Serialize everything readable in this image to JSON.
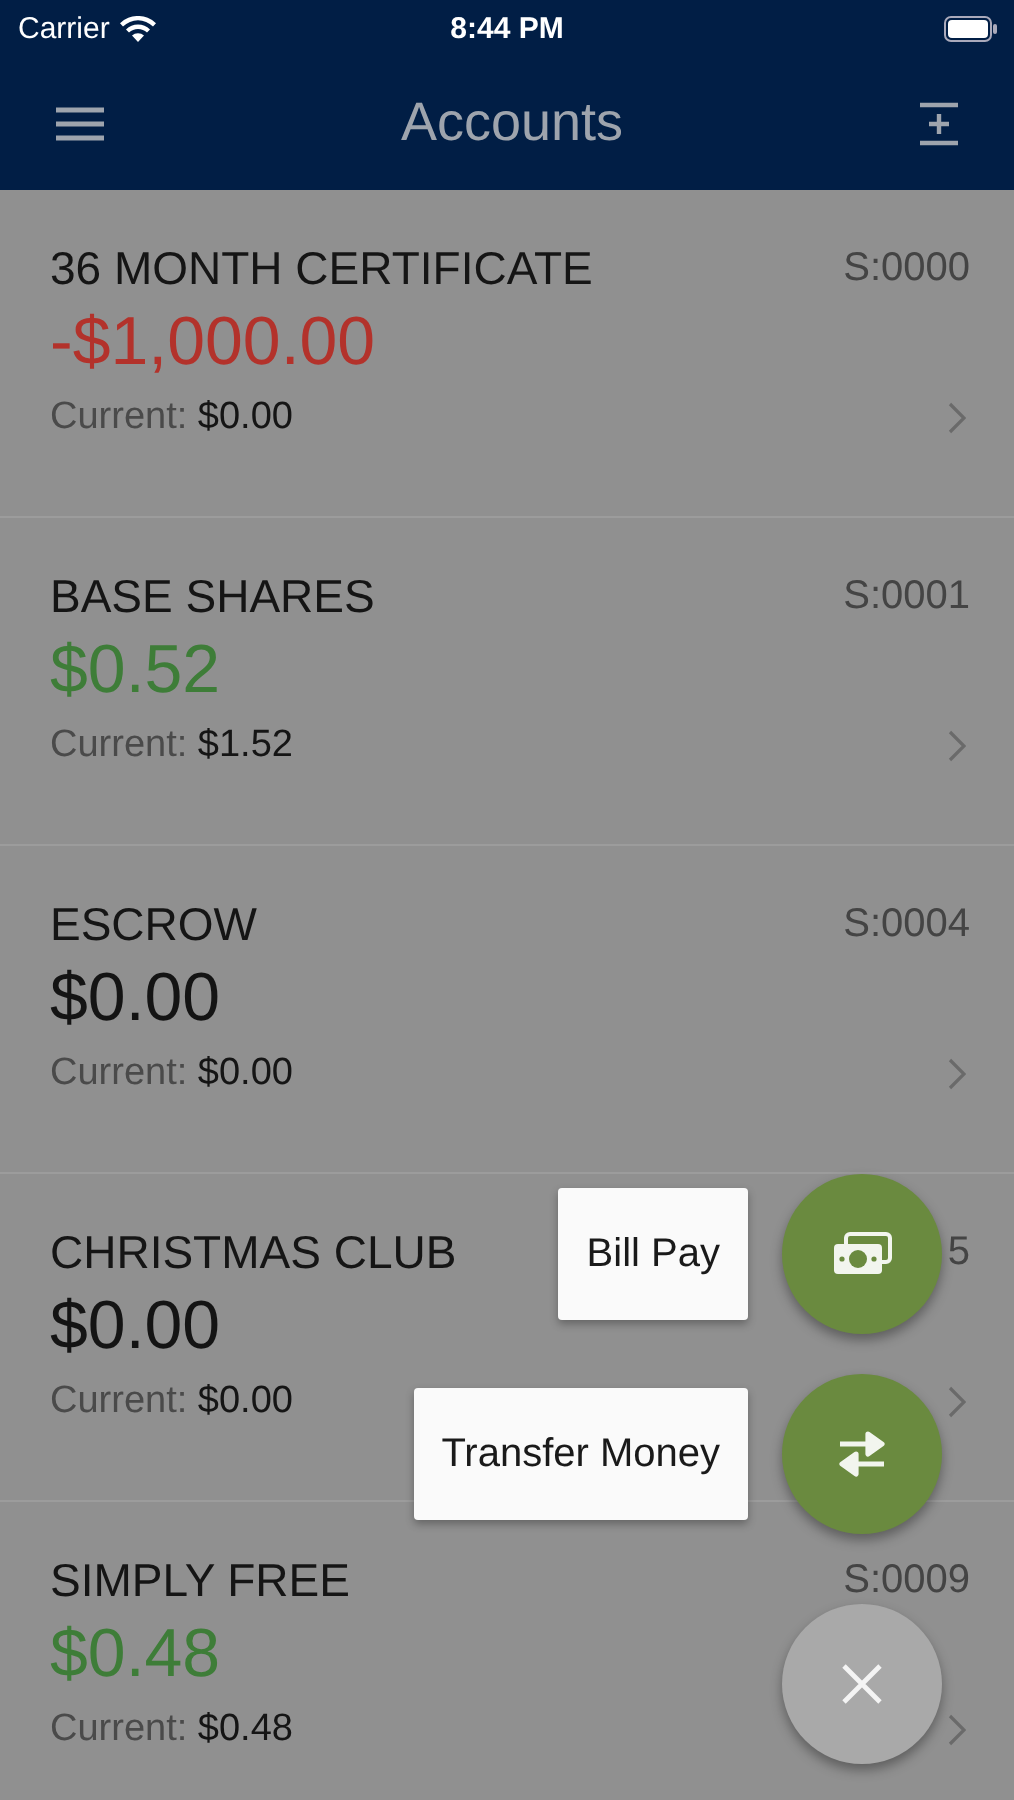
{
  "status_bar": {
    "carrier": "Carrier",
    "time": "8:44 PM"
  },
  "nav_bar": {
    "title": "Accounts"
  },
  "accounts": [
    {
      "name": "36 MONTH CERTIFICATE",
      "code": "S:0000",
      "balance": "-$1,000.00",
      "color": "#b3322b",
      "current_label": "Current:",
      "current": "$0.00"
    },
    {
      "name": "BASE SHARES",
      "code": "S:0001",
      "balance": "$0.52",
      "color": "#3e7d38",
      "current_label": "Current:",
      "current": "$1.52"
    },
    {
      "name": "ESCROW",
      "code": "S:0004",
      "balance": "$0.00",
      "color": "#141414",
      "current_label": "Current:",
      "current": "$0.00"
    },
    {
      "name": "CHRISTMAS CLUB",
      "code": "5",
      "balance": "$0.00",
      "color": "#141414",
      "current_label": "Current:",
      "current": "$0.00"
    },
    {
      "name": "SIMPLY FREE",
      "code": "S:0009",
      "balance": "$0.48",
      "color": "#3e7d38",
      "current_label": "Current:",
      "current": "$0.48"
    }
  ],
  "actions": [
    {
      "label": "Bill Pay",
      "kind": "bill"
    },
    {
      "label": "Transfer Money",
      "kind": "transfer"
    }
  ]
}
